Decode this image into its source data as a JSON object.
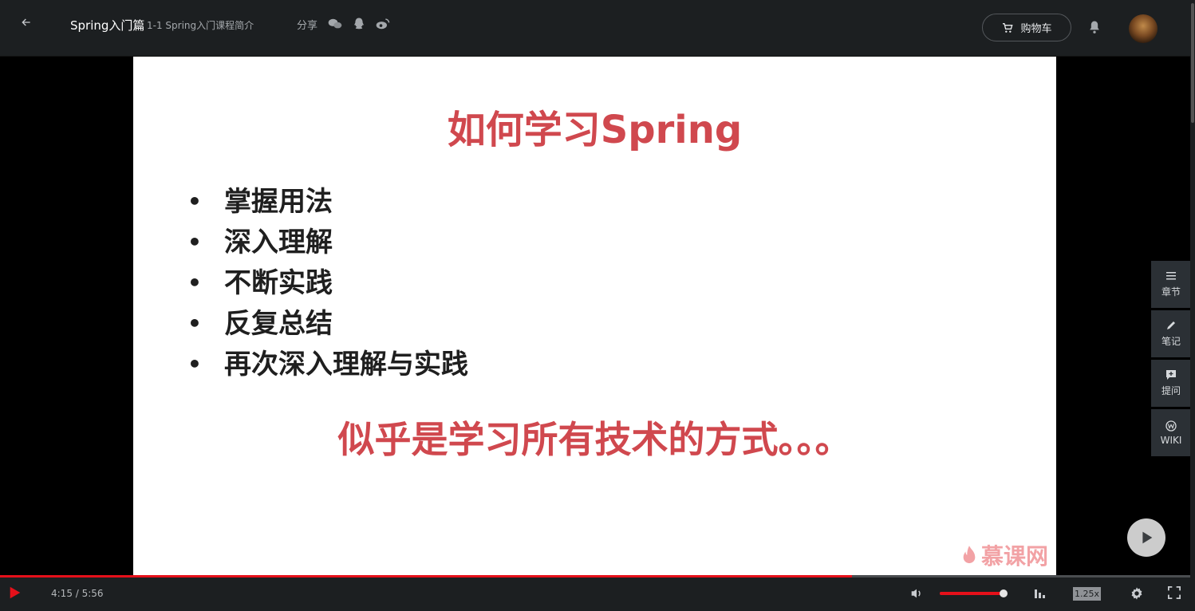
{
  "header": {
    "course_title": "Spring入门篇",
    "lesson_title": "1-1 Spring入门课程简介",
    "share_label": "分享",
    "cart_label": "购物车",
    "share_icons": [
      "wechat-icon",
      "qq-icon",
      "weibo-icon"
    ]
  },
  "slide": {
    "title": "如何学习Spring",
    "bullets": [
      "掌握用法",
      "深入理解",
      "不断实践",
      "反复总结",
      "再次深入理解与实践"
    ],
    "note": "似乎是学习所有技术的方式。。。",
    "watermark": "慕课网"
  },
  "side_panel": {
    "items": [
      {
        "label": "章节",
        "icon": "list-icon"
      },
      {
        "label": "笔记",
        "icon": "pencil-icon"
      },
      {
        "label": "提问",
        "icon": "question-icon"
      },
      {
        "label": "WIKI",
        "icon": "wiki-icon"
      }
    ]
  },
  "player": {
    "current_time": "4:15",
    "duration": "5:56",
    "time_display": "4:15 / 5:56",
    "progress_fraction": 0.716,
    "volume_fraction": 1.0,
    "speed_label": "1.25x"
  },
  "colors": {
    "accent_red": "#e5101a",
    "slide_red": "#d0484e",
    "bar_bg": "#1c1f21"
  }
}
